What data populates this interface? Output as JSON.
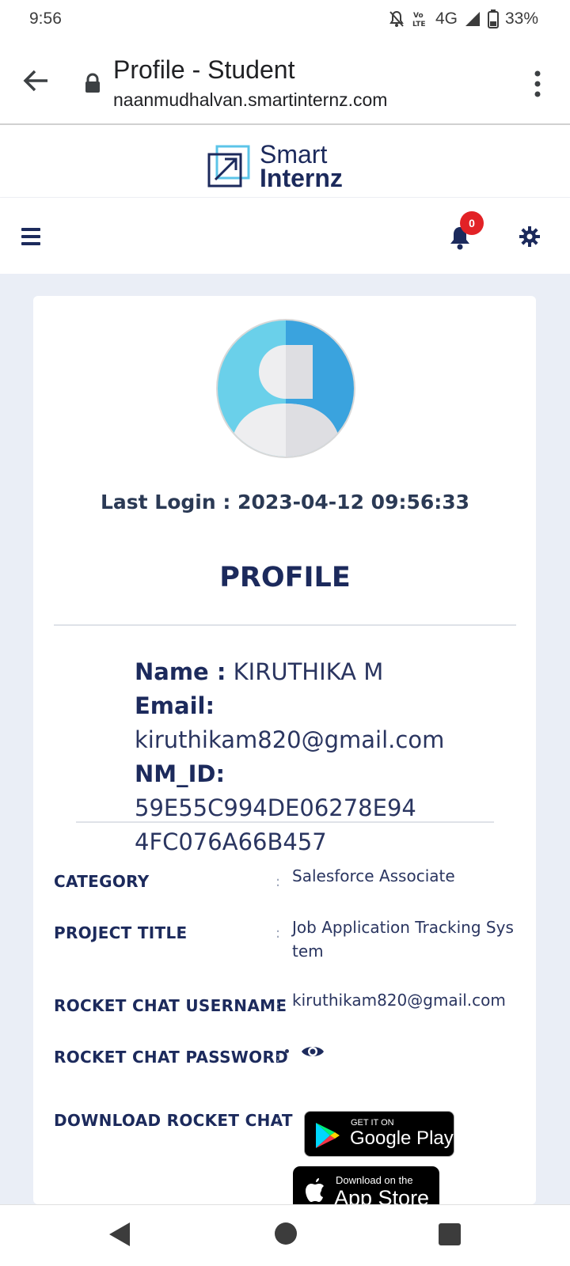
{
  "status_bar": {
    "time": "9:56",
    "network": "4G",
    "battery": "33%",
    "volte": "Vo LTE",
    "icons": [
      "mute-bell-icon",
      "volte-icon",
      "signal-icon",
      "battery-icon"
    ]
  },
  "browser": {
    "title": "Profile - Student",
    "url": "naanmudhalvan.smartinternz.com"
  },
  "site": {
    "logo_line1": "Smart",
    "logo_line2": "Internz",
    "notification_count": "0"
  },
  "profile": {
    "last_login": "Last Login : 2023-04-12 09:56:33",
    "heading": "PROFILE",
    "name_label": "Name :",
    "name_value": "KIRUTHIKA M",
    "email_label": "Email:",
    "email_value": "kiruthikam820@gmail.com",
    "nmid_label": "NM_ID:",
    "nmid_value_line1": "59E55C994DE06278E94",
    "nmid_value_line2": "4FC076A66B457"
  },
  "details": {
    "category_label": "CATEGORY",
    "category_value": "Salesforce Associate",
    "project_label": "PROJECT TITLE",
    "project_value_line1": "Job Application Tracking Sys",
    "project_value_line2": "tem",
    "rc_username_label": "ROCKET CHAT USERNAME",
    "rc_username_value": "kiruthikam820@gmail.com",
    "rc_password_label": "ROCKET CHAT PASSWORD",
    "download_label": "DOWNLOAD ROCKET CHAT",
    "colon": ":"
  },
  "stores": {
    "gplay_small": "GET IT ON",
    "gplay_big": "Google Play",
    "appstore_small": "Download on the",
    "appstore_big": "App Store"
  },
  "colors": {
    "brand_navy": "#1c2a5c",
    "badge_red": "#e22226",
    "background": "#eaeef6"
  }
}
